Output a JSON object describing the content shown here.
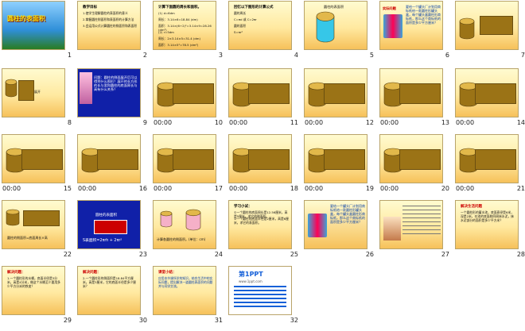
{
  "slides": [
    {
      "num": "1",
      "title": "圆柱的表面积"
    },
    {
      "num": "2",
      "title": "教学目标",
      "lines": [
        "1.使学生理解圆柱的表面积的意义",
        "2.掌握圆柱侧面积和表面积的计算方法",
        "3.会运用公式计算圆柱的侧面积和表面积"
      ]
    },
    {
      "num": "3",
      "title": "计算下面圆的周长和面积。",
      "lines": [
        "(1) d=6dm",
        "周长：3.14×6=18.84 (dm)",
        "面积：3.14×(6÷2)²=3.14×9=28.26 (dm²)",
        "(2) r=5dm",
        "周长：2×3.14×5=31.4 (dm)",
        "面积：3.14×5²=78.5 (dm²)"
      ]
    },
    {
      "num": "4",
      "title": "回忆以下图形的计算公式",
      "lines": [
        "圆的周长",
        "C=πd 或 C=2πr",
        "圆的面积",
        "S=πr²"
      ]
    },
    {
      "num": "5",
      "title": "圆柱的表面积"
    },
    {
      "num": "6",
      "title": "实际问题",
      "lines": [
        "要给一个罐头厂计划用商标纸给一款圆柱形罐头盒，每个罐头盒圆柱形商标纸，那么这个商标纸的面积是多少平方厘米？"
      ]
    },
    {
      "num": "7"
    },
    {
      "num": "8",
      "label": "展开"
    },
    {
      "num": "9",
      "lines": [
        "问题：圆柱的侧面展开后可以得到什么图形？展开的长方形的长与宽和圆柱的底面周长与高有什么关系？"
      ]
    },
    {
      "num": "10",
      "dur": "00:00"
    },
    {
      "num": "11",
      "dur": "00:00"
    },
    {
      "num": "12",
      "dur": "00:00"
    },
    {
      "num": "13",
      "dur": "00:00"
    },
    {
      "num": "14",
      "dur": "00:00"
    },
    {
      "num": "15",
      "dur": "00:00"
    },
    {
      "num": "16",
      "dur": "00:00"
    },
    {
      "num": "17",
      "dur": "00:00"
    },
    {
      "num": "18",
      "dur": "00:00"
    },
    {
      "num": "19",
      "dur": "00:00"
    },
    {
      "num": "20",
      "dur": "00:00"
    },
    {
      "num": "21",
      "dur": "00:00"
    },
    {
      "num": "22",
      "caption": "圆柱的侧面积=底面周长×高"
    },
    {
      "num": "23",
      "label": "圆柱的表面积",
      "formula": "S表面积=2πrh + 2πr²"
    },
    {
      "num": "24",
      "caption": "计算各圆柱的侧面积。(单位：cm)"
    },
    {
      "num": "25",
      "title": "学习小试：",
      "lines": [
        "①一个圆柱的底面周长是12.56厘米，高是5厘米，求它的侧面积。",
        "②一个圆柱的底面半径是2厘米，高是6厘米，求它的表面积。"
      ]
    },
    {
      "num": "26",
      "lines": [
        "要给一个罐头厂计划用商标纸给一款圆柱形罐头盒，每个罐头盒圆柱形商标纸，那么这个商标纸的面积是多少平方厘米？"
      ]
    },
    {
      "num": "27"
    },
    {
      "num": "28",
      "title": "解决生活问题",
      "lines": [
        "一个圆柱形的蓄水池，底面直径是6米，深是2米，在池的底面和四周抹水泥，抹水泥部分的面积是多少平方米？"
      ]
    },
    {
      "num": "29",
      "title": "解决问题：",
      "lines": [
        "1.一个圆柱形的水桶，底面半径是3分米，高是4分米，做这个水桶至少要用多少平方分米的铁皮？"
      ]
    },
    {
      "num": "30",
      "title": "解决问题：",
      "lines": [
        "2.一个圆柱形的侧面积是18.84平方厘米，高是3厘米，它的底面半径是多少厘米？"
      ]
    },
    {
      "num": "31",
      "title": "课堂小结：",
      "lines": [
        "应用本节课所学的知识，结合生活中的实际问题，提出解决一道圆柱表面积的问题并与同学交流。"
      ]
    },
    {
      "num": "32",
      "title": "第1PPT",
      "lines": [
        "www.1ppt.com"
      ]
    }
  ],
  "colors": {
    "slide_bg": "#ffe9a0",
    "cylinder": "#9b7316",
    "blue_slide": "#1020a8",
    "highlight": "#ffb400"
  }
}
